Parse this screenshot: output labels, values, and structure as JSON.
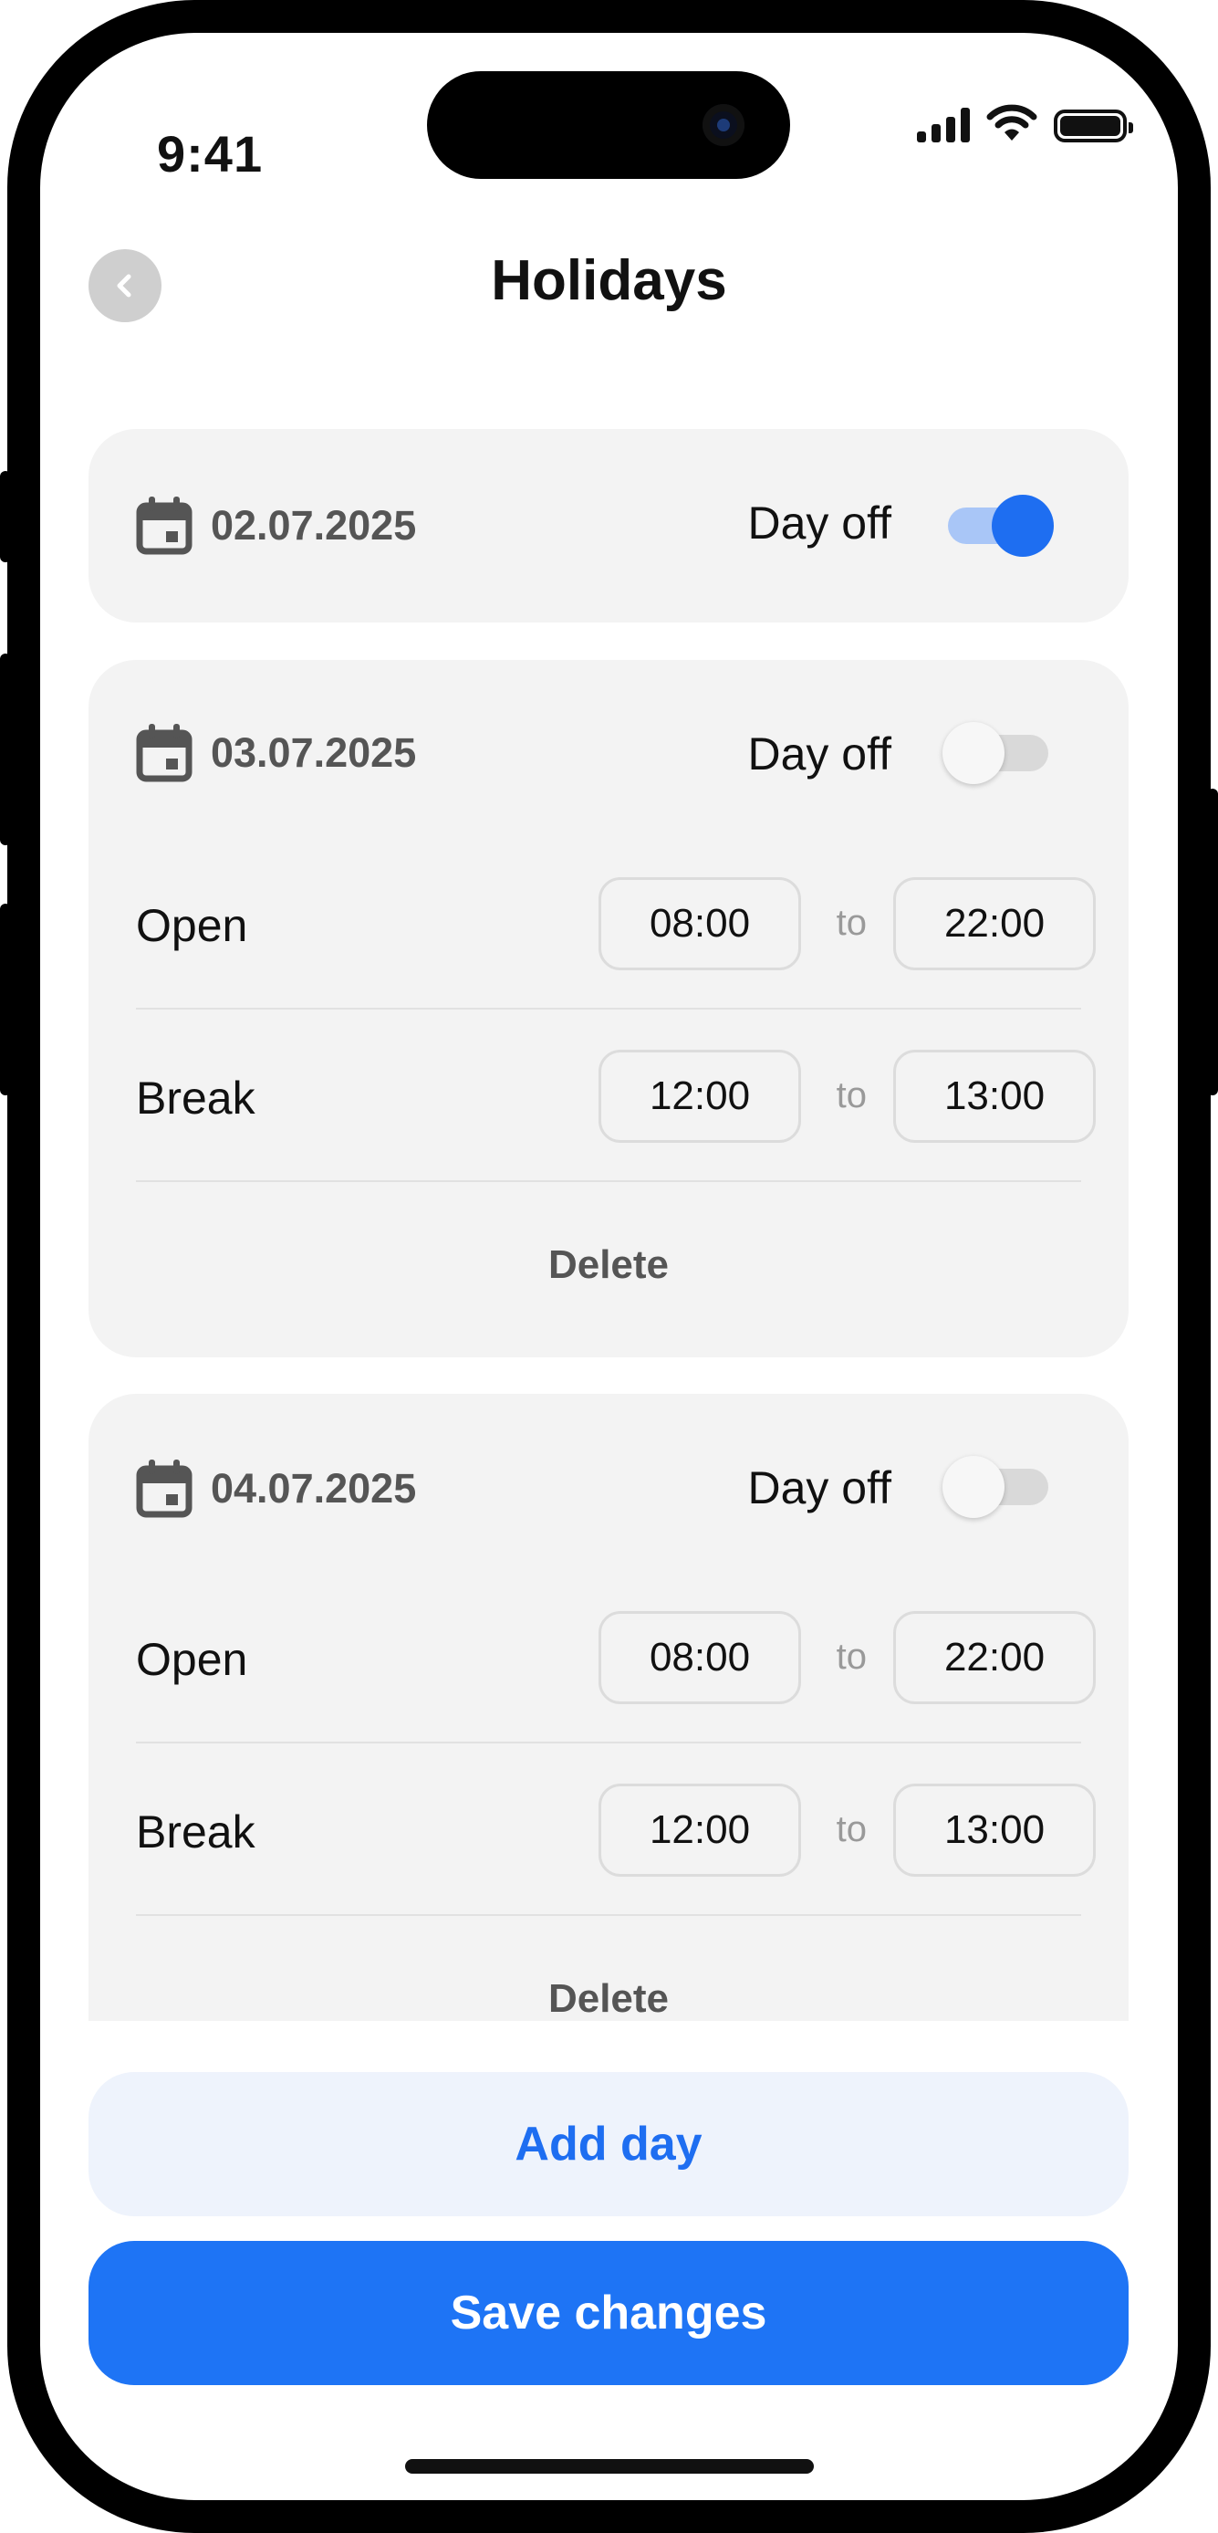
{
  "status_bar": {
    "time": "9:41"
  },
  "header": {
    "title": "Holidays"
  },
  "days": [
    {
      "date": "02.07.2025",
      "day_off_label": "Day off",
      "day_off": true
    },
    {
      "date": "03.07.2025",
      "day_off_label": "Day off",
      "day_off": false,
      "open": {
        "label": "Open",
        "from": "08:00",
        "separator": "to",
        "to": "22:00"
      },
      "break": {
        "label": "Break",
        "from": "12:00",
        "separator": "to",
        "to": "13:00"
      },
      "delete_label": "Delete"
    },
    {
      "date": "04.07.2025",
      "day_off_label": "Day off",
      "day_off": false,
      "open": {
        "label": "Open",
        "from": "08:00",
        "separator": "to",
        "to": "22:00"
      },
      "break": {
        "label": "Break",
        "from": "12:00",
        "separator": "to",
        "to": "13:00"
      },
      "delete_label": "Delete"
    }
  ],
  "actions": {
    "add_day": "Add day",
    "save": "Save changes"
  },
  "colors": {
    "accent": "#1e6ef1",
    "card_bg": "#f3f3f3",
    "secondary_btn_bg": "#eef3fc"
  },
  "icons": [
    "chevron-left-icon",
    "calendar-icon",
    "signal-icon",
    "wifi-icon",
    "battery-icon"
  ]
}
